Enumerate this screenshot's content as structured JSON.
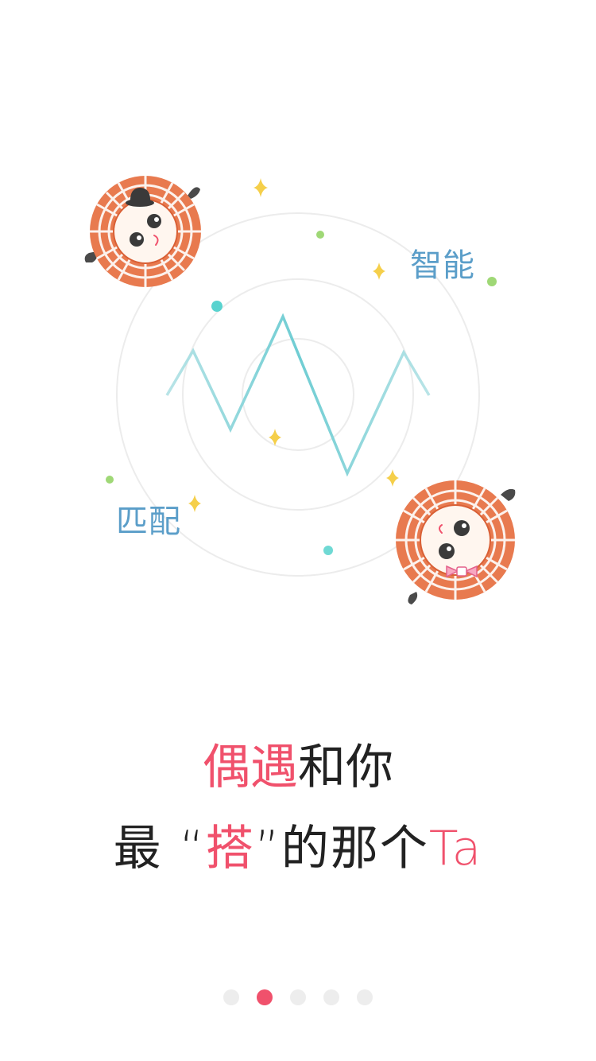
{
  "tags": {
    "smart": "智能",
    "match": "匹配"
  },
  "headline": {
    "line1_highlight": "偶遇",
    "line1_rest": "和你",
    "line2_prefix": "最",
    "line2_open_quote": "“",
    "line2_highlight": "搭",
    "line2_close_quote": "”",
    "line2_mid": "的那个",
    "line2_suffix": "Ta"
  },
  "pager": {
    "count": 5,
    "active_index": 1
  },
  "colors": {
    "accent": "#f0516c",
    "tag": "#5b9ec9",
    "wave": "#7dd3d8",
    "sparkle": "#f5cf4a",
    "mascot_ring": "#e87a4f"
  },
  "icons": {
    "mascot_top": "mascot-with-hat-icon",
    "mascot_bottom": "mascot-with-bow-icon",
    "sparkle": "sparkle-star-icon"
  }
}
